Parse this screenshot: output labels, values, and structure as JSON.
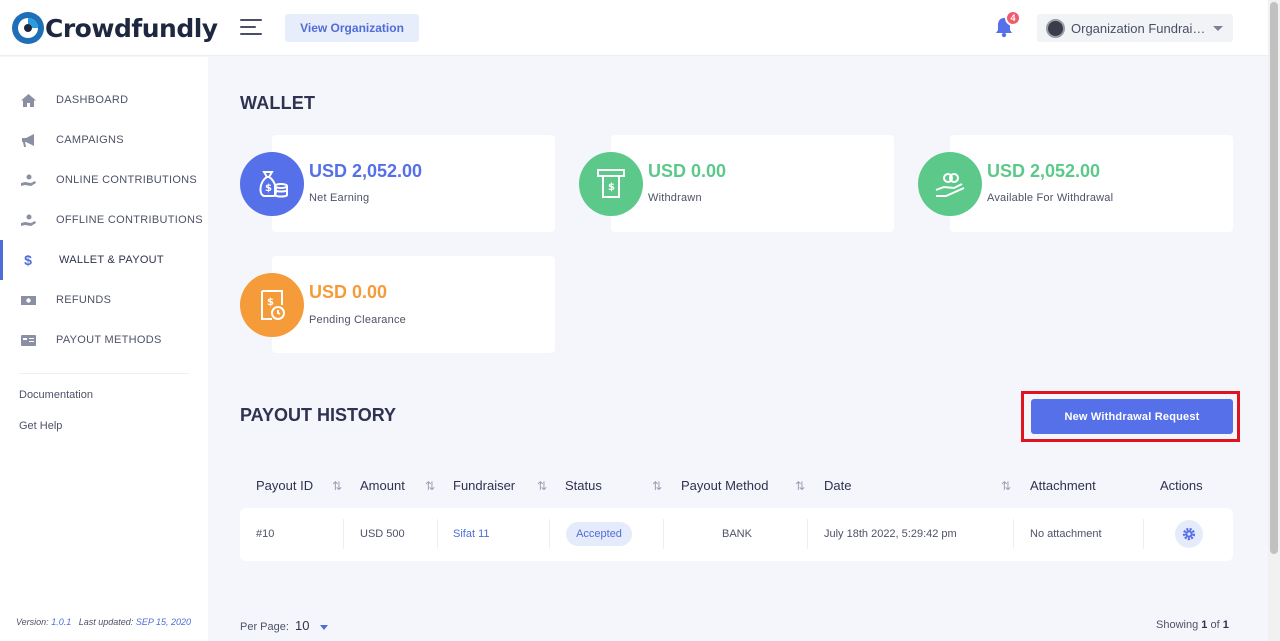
{
  "app": {
    "name": "Crowdfundly"
  },
  "header": {
    "view_org_label": "View Organization",
    "notification_count": "4",
    "org_name": "Organization Fundrai…"
  },
  "sidebar": {
    "items": [
      {
        "label": "DASHBOARD",
        "icon": "home-icon"
      },
      {
        "label": "CAMPAIGNS",
        "icon": "megaphone-icon"
      },
      {
        "label": "ONLINE CONTRIBUTIONS",
        "icon": "hand-coin-icon"
      },
      {
        "label": "OFFLINE CONTRIBUTIONS",
        "icon": "hand-coin-icon"
      },
      {
        "label": "WALLET & PAYOUT",
        "icon": "dollar-icon",
        "active": true
      },
      {
        "label": "REFUNDS",
        "icon": "cash-icon"
      },
      {
        "label": "PAYOUT METHODS",
        "icon": "card-icon"
      }
    ],
    "links": [
      "Documentation",
      "Get Help"
    ],
    "version_label": "Version:",
    "version": "1.0.1",
    "updated_label": "Last updated:",
    "updated": "SEP 15, 2020"
  },
  "wallet": {
    "title": "WALLET",
    "cards": [
      {
        "value": "USD 2,052.00",
        "label": "Net Earning",
        "color": "#5570e8",
        "icon": "money-bag-icon"
      },
      {
        "value": "USD 0.00",
        "label": "Withdrawn",
        "color": "#5cc98a",
        "icon": "atm-icon"
      },
      {
        "value": "USD 2,052.00",
        "label": "Available For Withdrawal",
        "color": "#5cc98a",
        "icon": "hand-money-icon"
      },
      {
        "value": "USD 0.00",
        "label": "Pending Clearance",
        "color": "#f59b3a",
        "icon": "receipt-clock-icon"
      }
    ]
  },
  "payout_history": {
    "title": "PAYOUT HISTORY",
    "new_request_label": "New Withdrawal Request",
    "columns": [
      "Payout ID",
      "Amount",
      "Fundraiser",
      "Status",
      "Payout Method",
      "Date",
      "Attachment",
      "Actions"
    ],
    "rows": [
      {
        "id": "#10",
        "amount": "USD 500",
        "fundraiser": "Sifat 11",
        "status": "Accepted",
        "method": "BANK",
        "date": "July 18th 2022, 5:29:42 pm",
        "attachment": "No attachment"
      }
    ]
  },
  "pagination": {
    "per_page_label": "Per Page:",
    "per_page": "10",
    "showing_label": "Showing",
    "current": "1",
    "of_label": "of",
    "total": "1"
  }
}
